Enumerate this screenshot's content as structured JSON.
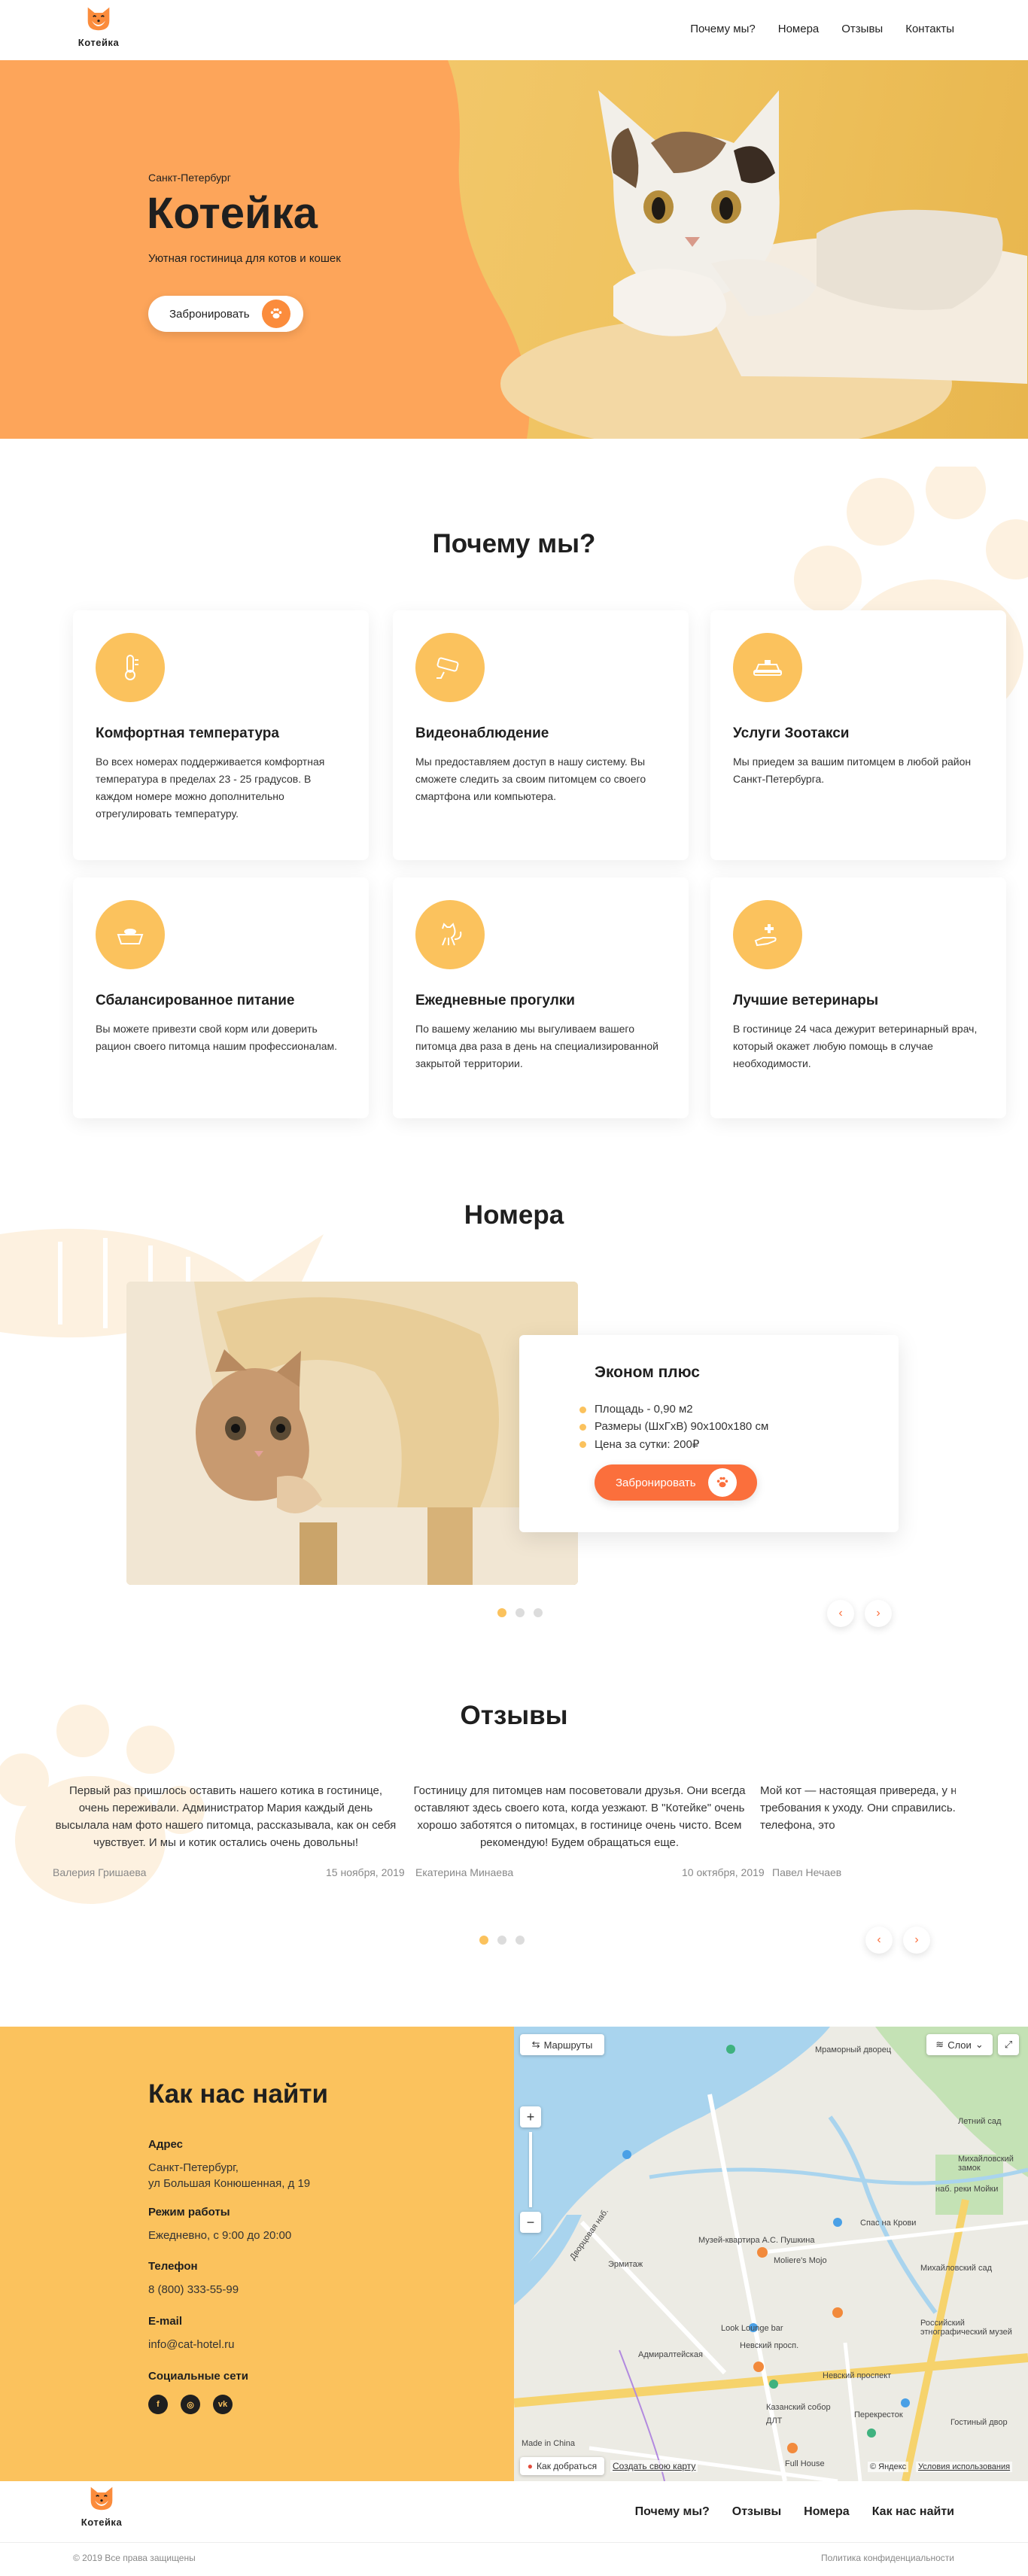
{
  "brand": {
    "name": "Котейка",
    "accent": "#fb6f3c",
    "orange": "#fda55a",
    "yellow": "#fbc25d"
  },
  "nav": {
    "items": [
      "Почему мы?",
      "Номера",
      "Отзывы",
      "Контакты"
    ]
  },
  "hero": {
    "city": "Санкт-Петербург",
    "title": "Котейка",
    "subtitle": "Уютная гостиница для котов и кошек",
    "button": "Забронировать"
  },
  "why": {
    "title": "Почему мы?",
    "cards": [
      {
        "icon": "thermometer-icon",
        "title": "Комфортная температура",
        "text": "Во всех номерах поддерживается комфортная температура в пределах 23 - 25 градусов. В каждом номере можно дополнительно отрегулировать температуру."
      },
      {
        "icon": "camera-icon",
        "title": "Видеонаблюдение",
        "text": "Мы предоставляем доступ в нашу систему. Вы сможете следить за своим питомцем со своего смартфона или компьютера."
      },
      {
        "icon": "taxi-icon",
        "title": "Услуги Зоотакси",
        "text": "Мы приедем за вашим питомцем в любой район Санкт-Петербурга."
      },
      {
        "icon": "food-bowl-icon",
        "title": "Сбалансированное питание",
        "text": "Вы можете привезти свой корм или доверить рацион своего питомца нашим профессионалам."
      },
      {
        "icon": "cat-walk-icon",
        "title": "Ежедневные прогулки",
        "text": "По вашему желанию мы выгуливаем вашего питомца два раза в день на специализированной закрытой территории."
      },
      {
        "icon": "vet-hand-icon",
        "title": "Лучшие ветеринары",
        "text": "В гостинице 24 часа дежурит ветеринарный врач, который окажет любую помощь в случае необходимости."
      }
    ]
  },
  "rooms": {
    "title": "Номера",
    "room": {
      "name": "Эконом плюс",
      "features": [
        "Площадь - 0,90 м2",
        "Размеры (ШхГхВ) 90х100х180 см",
        "Цена за сутки: 200₽"
      ],
      "button": "Забронировать"
    },
    "dots": 3,
    "active_dot": 0
  },
  "reviews": {
    "title": "Отзывы",
    "items": [
      {
        "text": "Первый раз пришлось оставить нашего котика в гостинице, очень переживали. Администратор Мария каждый день высылала нам фото нашего питомца, рассказывала, как он себя чувствует. И мы и котик остались очень довольны!",
        "author": "Валерия Гришаева",
        "date": "15 ноября, 2019"
      },
      {
        "text": "Гостиницу для питомцев нам посоветовали друзья. Они всегда оставляют здесь своего кота, когда уезжают. В \"Котейке\" очень хорошо заботятся о питомцах, в гостинице очень чисто. Всем рекомендую! Будем обращаться еще.",
        "author": "Екатерина Минаева",
        "date": "10 октября, 2019"
      },
      {
        "text": "Мой кот — настоящая привереда, у него были особые требования к уходу. Они справились. Я часто наблюдал по телефона, это",
        "author": "Павел Нечаев",
        "date": ""
      }
    ],
    "dots": 3,
    "active_dot": 0
  },
  "contacts": {
    "title": "Как нас найти",
    "address_label": "Адрес",
    "address_line1": "Санкт-Петербург,",
    "address_line2": "ул Большая Конюшенная, д 19",
    "hours_label": "Режим работы",
    "hours": "Ежедневно, с 9:00 до 20:00",
    "phone_label": "Телефон",
    "phone": "8 (800) 333-55-99",
    "email_label": "E-mail",
    "email": "info@cat-hotel.ru",
    "social_label": "Социальные сети",
    "social": [
      {
        "icon": "facebook-icon",
        "glyph": "f"
      },
      {
        "icon": "instagram-icon",
        "glyph": "◎"
      },
      {
        "icon": "vk-icon",
        "glyph": "vk"
      }
    ]
  },
  "map": {
    "routes": "Маршруты",
    "layers": "Слои",
    "zoom_in": "+",
    "zoom_out": "−",
    "get_there": "Как добраться",
    "create_map": "Создать свою карту",
    "copyright": "© Яндекс",
    "terms": "Условия использования",
    "labels": [
      "Мраморный дворец",
      "Летний сад",
      "Музей-квартира А.С. Пушкина",
      "Михайловский сад",
      "Эрмитаж",
      "Адмиралтейская",
      "Невский просп.",
      "Невский проспект",
      "Гостиный двор",
      "Казанский собор",
      "Спас на Крови",
      "Перекресток",
      "Made in China",
      "Look Lounge bar",
      "Full House",
      "ДЛТ",
      "Российский этнографический музей",
      "Moliere's Mojo",
      "Дворцовая наб.",
      "наб. реки Мойки",
      "Михайловский замок"
    ]
  },
  "footer": {
    "nav": [
      "Почему мы?",
      "Отзывы",
      "Номера",
      "Как нас найти"
    ],
    "copyright": "© 2019 Все права защищены",
    "privacy": "Политика конфиденциальности"
  }
}
